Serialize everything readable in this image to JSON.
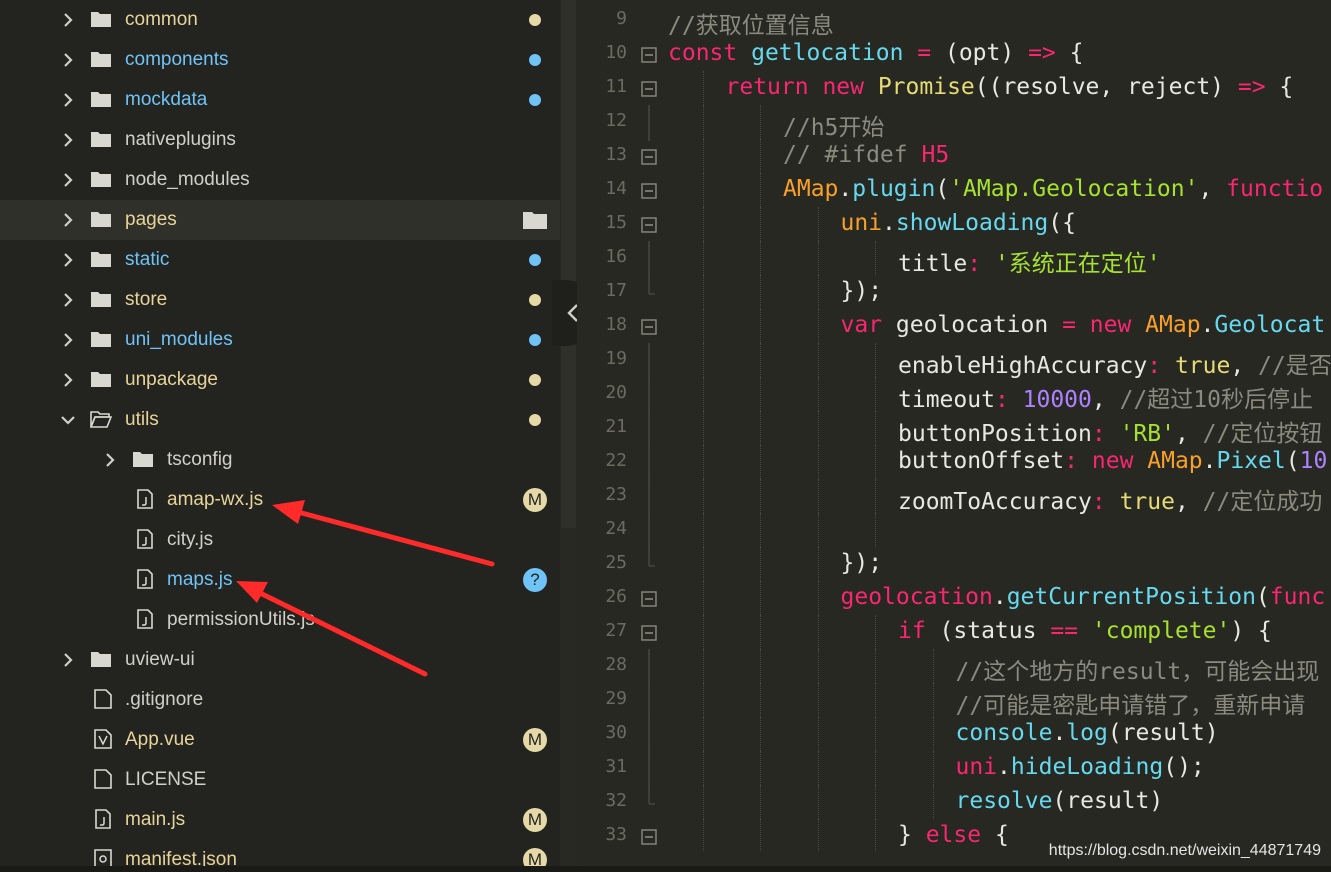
{
  "colors": {
    "sidebar_bg": "#23241f",
    "editor_bg": "#272822",
    "folder_text": "#e6c07b",
    "modified_badge": "#e6d9a8",
    "untracked_badge": "#6fc3f7",
    "arrow": "#ff2a2a"
  },
  "tree": [
    {
      "label": "common",
      "type": "folder",
      "chevron": "right",
      "depth": 0,
      "color": "#e8d49a",
      "badge": "dot-yellow"
    },
    {
      "label": "components",
      "type": "folder",
      "chevron": "right",
      "depth": 0,
      "color": "#6fc3f7",
      "badge": "dot-blue"
    },
    {
      "label": "mockdata",
      "type": "folder",
      "chevron": "right",
      "depth": 0,
      "color": "#6fc3f7",
      "badge": "dot-blue"
    },
    {
      "label": "nativeplugins",
      "type": "folder",
      "chevron": "right",
      "depth": 0,
      "color": "#d0d0c8",
      "badge": ""
    },
    {
      "label": "node_modules",
      "type": "folder",
      "chevron": "right",
      "depth": 0,
      "color": "#d0d0c8",
      "badge": ""
    },
    {
      "label": "pages",
      "type": "folder",
      "chevron": "right",
      "depth": 0,
      "color": "#e8d49a",
      "badge": "folder",
      "selected": true
    },
    {
      "label": "static",
      "type": "folder",
      "chevron": "right",
      "depth": 0,
      "color": "#6fc3f7",
      "badge": "dot-blue"
    },
    {
      "label": "store",
      "type": "folder",
      "chevron": "right",
      "depth": 0,
      "color": "#e8d49a",
      "badge": "dot-yellow"
    },
    {
      "label": "uni_modules",
      "type": "folder",
      "chevron": "right",
      "depth": 0,
      "color": "#6fc3f7",
      "badge": "dot-blue"
    },
    {
      "label": "unpackage",
      "type": "folder",
      "chevron": "right",
      "depth": 0,
      "color": "#e8d49a",
      "badge": "dot-yellow"
    },
    {
      "label": "utils",
      "type": "folder-open",
      "chevron": "down",
      "depth": 0,
      "color": "#e8d49a",
      "badge": "dot-yellow"
    },
    {
      "label": "tsconfig",
      "type": "folder",
      "chevron": "right",
      "depth": 1,
      "color": "#d0d0c8",
      "badge": ""
    },
    {
      "label": "amap-wx.js",
      "type": "file-js",
      "chevron": "",
      "depth": 1,
      "color": "#e8d49a",
      "badge": "M"
    },
    {
      "label": "city.js",
      "type": "file-js",
      "chevron": "",
      "depth": 1,
      "color": "#d0d0c8",
      "badge": ""
    },
    {
      "label": "maps.js",
      "type": "file-js",
      "chevron": "",
      "depth": 1,
      "color": "#6fc3f7",
      "badge": "?"
    },
    {
      "label": "permissionUtils.js",
      "type": "file-js",
      "chevron": "",
      "depth": 1,
      "color": "#d0d0c8",
      "badge": ""
    },
    {
      "label": "uview-ui",
      "type": "folder",
      "chevron": "right",
      "depth": 0,
      "color": "#d0d0c8",
      "badge": ""
    },
    {
      "label": ".gitignore",
      "type": "file",
      "chevron": "",
      "depth": 0,
      "color": "#d0d0c8",
      "badge": ""
    },
    {
      "label": "App.vue",
      "type": "file-vue",
      "chevron": "",
      "depth": 0,
      "color": "#e8d49a",
      "badge": "M"
    },
    {
      "label": "LICENSE",
      "type": "file",
      "chevron": "",
      "depth": 0,
      "color": "#d0d0c8",
      "badge": ""
    },
    {
      "label": "main.js",
      "type": "file-js",
      "chevron": "",
      "depth": 0,
      "color": "#e8d49a",
      "badge": "M"
    },
    {
      "label": "manifest.json",
      "type": "file-json",
      "chevron": "",
      "depth": 0,
      "color": "#e8d49a",
      "badge": "M"
    }
  ],
  "code_lines": [
    {
      "num": "9",
      "fold": "",
      "indent": 0,
      "tokens": [
        [
          "cmt",
          "//获取位置信息"
        ]
      ]
    },
    {
      "num": "10",
      "fold": "box",
      "indent": 0,
      "tokens": [
        [
          "kw",
          "const "
        ],
        [
          "fn",
          "getlocation"
        ],
        [
          "op",
          " = "
        ],
        [
          "prop",
          "(opt) "
        ],
        [
          "op",
          "=>"
        ],
        [
          "prop",
          " {"
        ]
      ]
    },
    {
      "num": "11",
      "fold": "box",
      "indent": 1,
      "tokens": [
        [
          "kw",
          "return "
        ],
        [
          "kw",
          "new "
        ],
        [
          "cls",
          "Promise"
        ],
        [
          "prop",
          "((resolve, reject) "
        ],
        [
          "op",
          "=>"
        ],
        [
          "prop",
          " {"
        ]
      ]
    },
    {
      "num": "12",
      "fold": "line",
      "indent": 2,
      "tokens": [
        [
          "cmt",
          "//h5开始"
        ]
      ]
    },
    {
      "num": "13",
      "fold": "box",
      "indent": 2,
      "tokens": [
        [
          "cmt",
          "// #ifdef "
        ],
        [
          "kw",
          "H5"
        ]
      ]
    },
    {
      "num": "14",
      "fold": "box",
      "indent": 2,
      "tokens": [
        [
          "obj",
          "AMap"
        ],
        [
          "prop",
          "."
        ],
        [
          "fn",
          "plugin"
        ],
        [
          "prop",
          "("
        ],
        [
          "str",
          "'AMap.Geolocation'"
        ],
        [
          "prop",
          ", "
        ],
        [
          "kw",
          "functio"
        ]
      ]
    },
    {
      "num": "15",
      "fold": "box",
      "indent": 3,
      "tokens": [
        [
          "obj",
          "uni"
        ],
        [
          "prop",
          "."
        ],
        [
          "fn",
          "showLoading"
        ],
        [
          "prop",
          "({"
        ]
      ]
    },
    {
      "num": "16",
      "fold": "line",
      "indent": 4,
      "tokens": [
        [
          "prop",
          "title"
        ],
        [
          "op",
          ": "
        ],
        [
          "str",
          "'系统正在定位'"
        ]
      ]
    },
    {
      "num": "17",
      "fold": "end",
      "indent": 3,
      "tokens": [
        [
          "prop",
          "});"
        ]
      ]
    },
    {
      "num": "18",
      "fold": "box",
      "indent": 3,
      "tokens": [
        [
          "kw",
          "var "
        ],
        [
          "prop",
          "geolocation "
        ],
        [
          "op",
          "= "
        ],
        [
          "kw",
          "new "
        ],
        [
          "obj",
          "AMap"
        ],
        [
          "prop",
          "."
        ],
        [
          "fn",
          "Geolocat"
        ]
      ]
    },
    {
      "num": "19",
      "fold": "line",
      "indent": 4,
      "tokens": [
        [
          "prop",
          "enableHighAccuracy"
        ],
        [
          "op",
          ": "
        ],
        [
          "bool",
          "true"
        ],
        [
          "prop",
          ", "
        ],
        [
          "cmt",
          "//是否"
        ]
      ]
    },
    {
      "num": "20",
      "fold": "line",
      "indent": 4,
      "tokens": [
        [
          "prop",
          "timeout"
        ],
        [
          "op",
          ": "
        ],
        [
          "num",
          "10000"
        ],
        [
          "prop",
          ", "
        ],
        [
          "cmt",
          "//超过10秒后停止"
        ]
      ]
    },
    {
      "num": "21",
      "fold": "line",
      "indent": 4,
      "tokens": [
        [
          "prop",
          "buttonPosition"
        ],
        [
          "op",
          ": "
        ],
        [
          "str",
          "'RB'"
        ],
        [
          "prop",
          ", "
        ],
        [
          "cmt",
          "//定位按钮"
        ]
      ]
    },
    {
      "num": "22",
      "fold": "line",
      "indent": 4,
      "tokens": [
        [
          "prop",
          "buttonOffset"
        ],
        [
          "op",
          ": "
        ],
        [
          "kw",
          "new "
        ],
        [
          "obj",
          "AMap"
        ],
        [
          "prop",
          "."
        ],
        [
          "fn",
          "Pixel"
        ],
        [
          "prop",
          "("
        ],
        [
          "num",
          "10"
        ]
      ]
    },
    {
      "num": "23",
      "fold": "line",
      "indent": 4,
      "tokens": [
        [
          "prop",
          "zoomToAccuracy"
        ],
        [
          "op",
          ": "
        ],
        [
          "bool",
          "true"
        ],
        [
          "prop",
          ", "
        ],
        [
          "cmt",
          "//定位成功"
        ]
      ]
    },
    {
      "num": "24",
      "fold": "line",
      "indent": 4,
      "tokens": []
    },
    {
      "num": "25",
      "fold": "end",
      "indent": 3,
      "tokens": [
        [
          "prop",
          "});"
        ]
      ]
    },
    {
      "num": "26",
      "fold": "box",
      "indent": 3,
      "tokens": [
        [
          "kw",
          "geolocation"
        ],
        [
          "prop",
          "."
        ],
        [
          "fn",
          "getCurrentPosition"
        ],
        [
          "prop",
          "("
        ],
        [
          "kw",
          "func"
        ]
      ]
    },
    {
      "num": "27",
      "fold": "box",
      "indent": 4,
      "tokens": [
        [
          "kw",
          "if "
        ],
        [
          "prop",
          "(status "
        ],
        [
          "op",
          "== "
        ],
        [
          "str",
          "'complete'"
        ],
        [
          "prop",
          ") {"
        ]
      ]
    },
    {
      "num": "28",
      "fold": "line",
      "indent": 5,
      "tokens": [
        [
          "cmt",
          "//这个地方的result，可能会出现"
        ]
      ]
    },
    {
      "num": "29",
      "fold": "line",
      "indent": 5,
      "tokens": [
        [
          "cmt",
          "//可能是密匙申请错了，重新申请"
        ]
      ]
    },
    {
      "num": "30",
      "fold": "line",
      "indent": 5,
      "tokens": [
        [
          "fn",
          "console"
        ],
        [
          "prop",
          "."
        ],
        [
          "fn",
          "log"
        ],
        [
          "prop",
          "(result)"
        ]
      ]
    },
    {
      "num": "31",
      "fold": "line",
      "indent": 5,
      "tokens": [
        [
          "kw",
          "uni"
        ],
        [
          "prop",
          "."
        ],
        [
          "fn",
          "hideLoading"
        ],
        [
          "prop",
          "();"
        ]
      ]
    },
    {
      "num": "32",
      "fold": "end",
      "indent": 5,
      "tokens": [
        [
          "fn",
          "resolve"
        ],
        [
          "prop",
          "(result)"
        ]
      ]
    },
    {
      "num": "33",
      "fold": "box",
      "indent": 4,
      "tokens": [
        [
          "prop",
          "} "
        ],
        [
          "kw",
          "else"
        ],
        [
          "prop",
          " {"
        ]
      ]
    }
  ],
  "watermark": "https://blog.csdn.net/weixin_44871749"
}
